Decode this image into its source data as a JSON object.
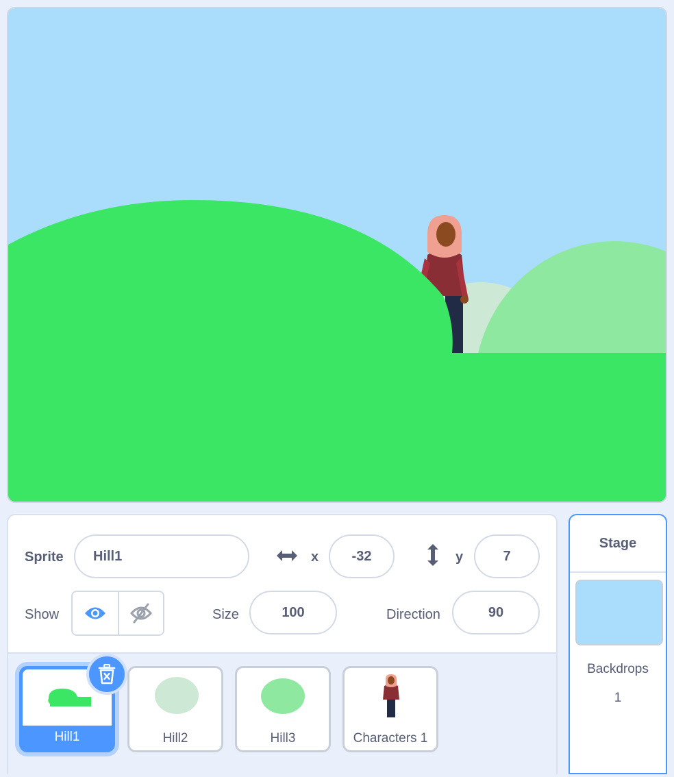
{
  "sprite_info": {
    "sprite_label": "Sprite",
    "sprite_name": "Hill1",
    "x_label": "x",
    "x_value": "-32",
    "y_label": "y",
    "y_value": "7",
    "show_label": "Show",
    "size_label": "Size",
    "size_value": "100",
    "direction_label": "Direction",
    "direction_value": "90"
  },
  "sprites": [
    {
      "name": "Hill1",
      "selected": true
    },
    {
      "name": "Hill2",
      "selected": false
    },
    {
      "name": "Hill3",
      "selected": false
    },
    {
      "name": "Characters 1",
      "selected": false
    }
  ],
  "stage_panel": {
    "title": "Stage",
    "backdrops_label": "Backdrops",
    "backdrops_count": "1"
  },
  "colors": {
    "sky": "#aadcfc",
    "hill_main": "#3ae664",
    "hill_light": "#8fe8a0",
    "hill_pale": "#cde8d4",
    "accent_blue": "#4c97ff"
  }
}
